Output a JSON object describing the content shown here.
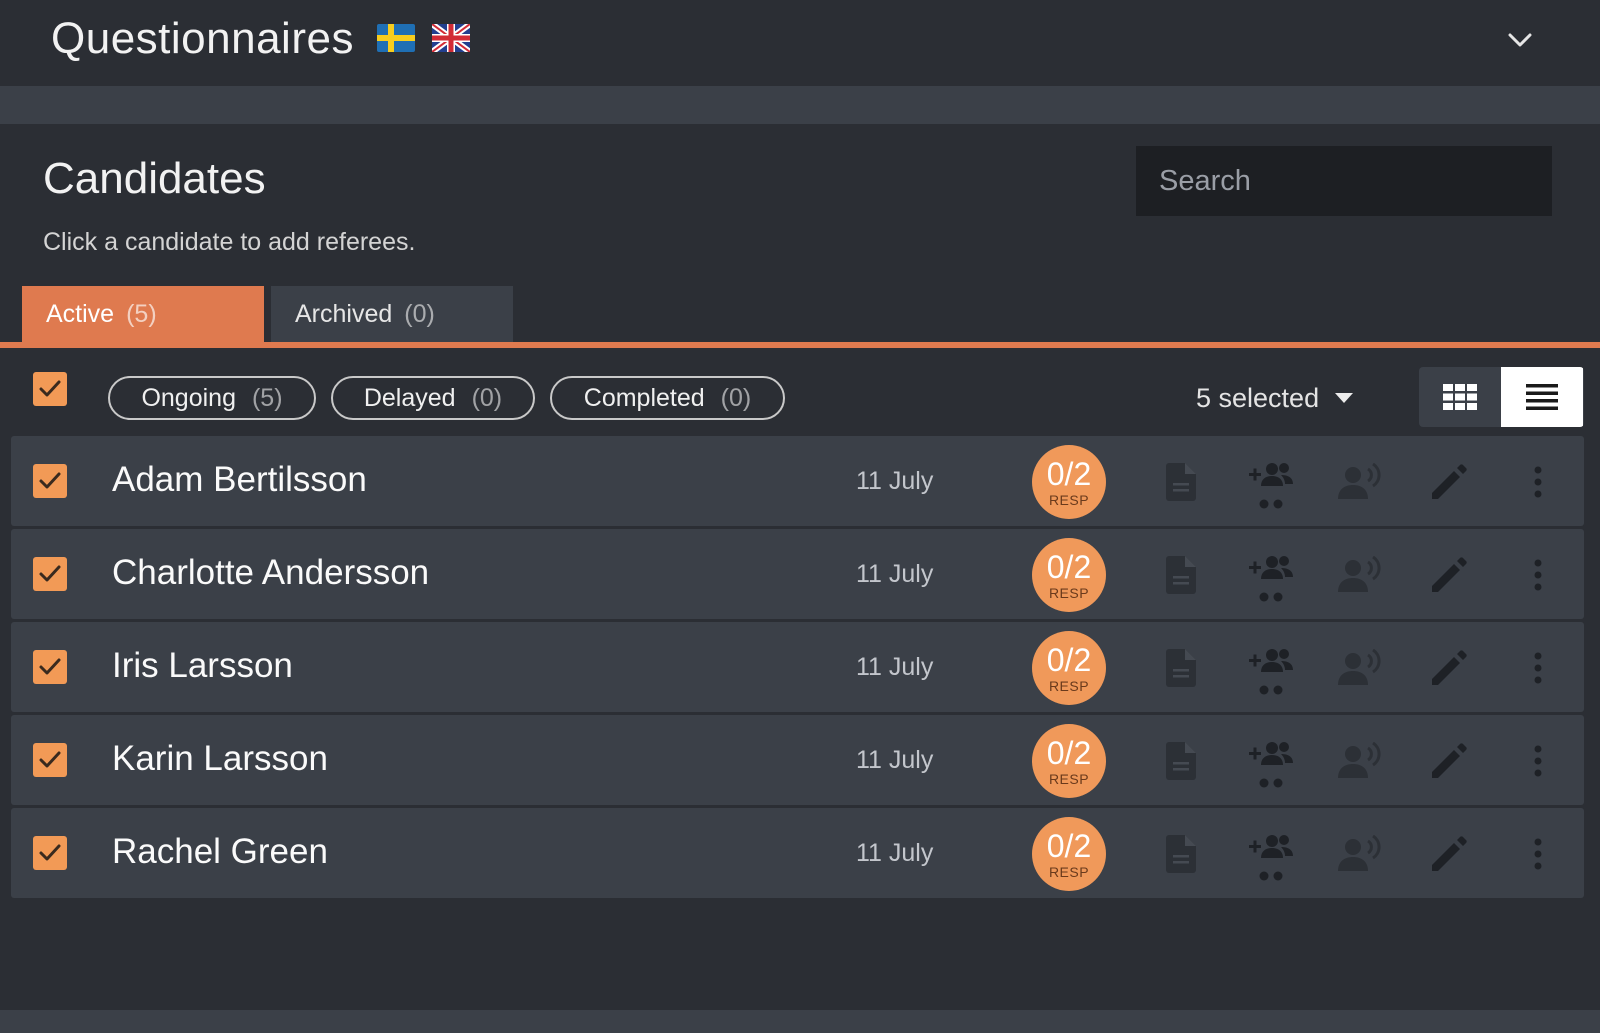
{
  "header": {
    "title": "Questionnaires",
    "languages": [
      "swedish-flag",
      "uk-flag"
    ]
  },
  "panel": {
    "title": "Candidates",
    "subtitle": "Click a candidate to add referees.",
    "search_placeholder": "Search"
  },
  "tabs": [
    {
      "label": "Active",
      "count": "(5)",
      "active": true
    },
    {
      "label": "Archived",
      "count": "(0)",
      "active": false
    }
  ],
  "filters": [
    {
      "label": "Ongoing",
      "count": "(5)"
    },
    {
      "label": "Delayed",
      "count": "(0)"
    },
    {
      "label": "Completed",
      "count": "(0)"
    }
  ],
  "selection": {
    "label": "5 selected",
    "all_checked": true
  },
  "view": {
    "modes": [
      "grid-view-icon",
      "list-view-icon"
    ],
    "active": "list"
  },
  "candidates": [
    {
      "name": "Adam Bertilsson",
      "date": "11 July",
      "responses": "0/2",
      "resp_label": "RESP",
      "checked": true
    },
    {
      "name": "Charlotte Andersson",
      "date": "11 July",
      "responses": "0/2",
      "resp_label": "RESP",
      "checked": true
    },
    {
      "name": "Iris Larsson",
      "date": "11 July",
      "responses": "0/2",
      "resp_label": "RESP",
      "checked": true
    },
    {
      "name": "Karin Larsson",
      "date": "11 July",
      "responses": "0/2",
      "resp_label": "RESP",
      "checked": true
    },
    {
      "name": "Rachel Green",
      "date": "11 July",
      "responses": "0/2",
      "resp_label": "RESP",
      "checked": true
    }
  ],
  "colors": {
    "accent": "#df7a4f",
    "checkbox": "#f29a56",
    "badge": "#f0995a",
    "background": "#2b2e34",
    "row": "#3b4048"
  }
}
